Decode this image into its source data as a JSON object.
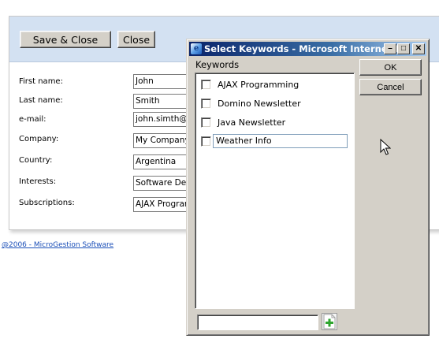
{
  "form": {
    "save_close_label": "Save & Close",
    "close_label": "Close",
    "fields": [
      {
        "label": "First name:",
        "value": "John"
      },
      {
        "label": "Last name:",
        "value": "Smith"
      },
      {
        "label": "e-mail:",
        "value": "john.simth@m"
      },
      {
        "label": "Company:",
        "value": "My Company"
      },
      {
        "label": "Country:",
        "value": "Argentina"
      },
      {
        "label": "Interests:",
        "value": "Software Dev"
      },
      {
        "label": "Subscriptions:",
        "value": "AJAX Progran"
      }
    ],
    "footer_link": "@2006 - MicroGestion Software"
  },
  "popup": {
    "title": "Select Keywords - Microsoft Internet E...",
    "icon": "ie-icon",
    "group_label": "Keywords",
    "ok_label": "OK",
    "cancel_label": "Cancel",
    "keywords": [
      {
        "label": "AJAX Programming",
        "checked": false
      },
      {
        "label": "Domino Newsletter",
        "checked": false
      },
      {
        "label": "Java Newsletter",
        "checked": false
      },
      {
        "label": "Weather Info",
        "checked": false,
        "editing": true
      }
    ],
    "new_keyword_value": "",
    "add_icon": "add-green-plus-icon"
  }
}
